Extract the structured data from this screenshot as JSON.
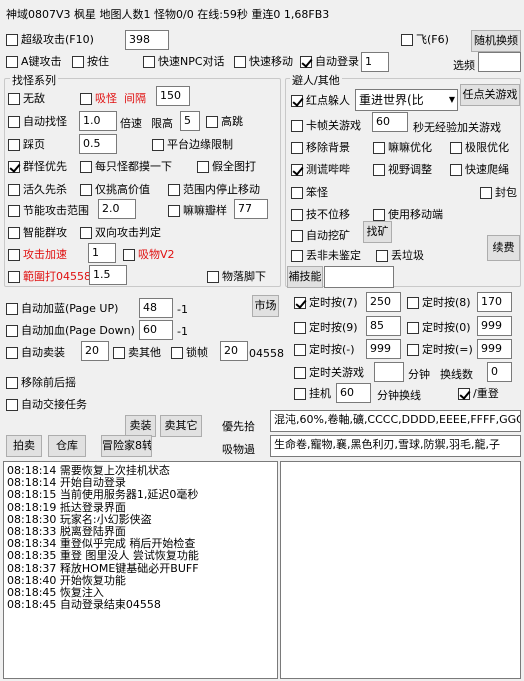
{
  "title": "神域0807V3 枫星 地图人数1 怪物0/0 在线:59秒 重连0   1,68FB3",
  "top": {
    "super_attack": {
      "label": "超级攻击(F10)",
      "value": "398",
      "checked": false
    },
    "fly": {
      "label": "飞(F6)",
      "checked": false
    },
    "random_swap_btn": "随机换频",
    "a_attack": {
      "label": "A键攻击",
      "checked": false
    },
    "hold": {
      "label": "按住",
      "checked": false
    },
    "fast_npc": {
      "label": "快速NPC对话",
      "checked": false
    },
    "fast_move": {
      "label": "快速移动",
      "checked": false
    },
    "auto_login": {
      "label": "自动登录",
      "value": "1",
      "checked": true
    },
    "select_label": "选频"
  },
  "monster": {
    "group_label": "找怪系列",
    "invincible": "无敌",
    "suck_monster": "吸怪",
    "interval": "间隔",
    "interval_value": "150",
    "auto_find": "自动找怪",
    "speed_value": "1.0",
    "speed_label": "倍速",
    "height_limit": "限高",
    "height_value": "5",
    "high_jump": "高跳",
    "step_back": "踩页",
    "step_value": "0.5",
    "platform_limit": "平台边缘限制",
    "group_first": "群怪优先",
    "touch_each": "每只怪都摸一下",
    "fake_map": "假全图打",
    "live_kill": "活久先杀",
    "attack_high": "仅挑高价值",
    "stop_in_range": "范围内停止移动",
    "save_range": "节能攻击范围",
    "save_range_value": "2.0",
    "bite": "嘛嘛瓣样",
    "bite_value": "77",
    "smart_group": "智能群攻",
    "bidirectional": "双向攻击判定",
    "attack_speed": "攻击加速",
    "attack_speed_value": "1",
    "suck_v2": "吸物V2",
    "range_attack": "範圍打04558",
    "range_attack_value": "1.5",
    "item_under_foot": "物落脚下"
  },
  "other": {
    "group_label": "避人/其他",
    "red_dot": {
      "label": "红点躲人",
      "checked": true
    },
    "red_dot_select": "重进世界(比",
    "red_dot_btn": "任点关游戏",
    "stuck_close": "卡帧关游戏",
    "stuck_value": "60",
    "stuck_suffix": "秒无经验加关游戏",
    "move_bg": "移除背景",
    "blur_opt": "嘛嘛优化",
    "extreme_opt": "极限优化",
    "measure_beep": {
      "label": "测谎哔哔",
      "checked": true
    },
    "view_adjust": "视野调整",
    "fast_climb": "快速爬绳",
    "clumsy": "笨怪",
    "seal": "封包",
    "no_move": "技不位移",
    "use_move_end": "使用移动端",
    "auto_mine": "自动挖矿",
    "find_mine_btn": "找矿",
    "lose_unjudged": "丢非未鉴定",
    "lose_trash": "丢垃圾",
    "buy_btn": "補技能",
    "continue_btn": "续费",
    "buy_input": ""
  },
  "mid": {
    "auto_mp": {
      "label": "自动加蓝(Page UP)",
      "value": "48",
      "suffix": "-1"
    },
    "auto_hp": {
      "label": "自动加血(Page Down)",
      "value": "60",
      "suffix": "-1"
    },
    "market_btn": "市场",
    "auto_sell": {
      "label": "自动卖装",
      "value": "20"
    },
    "sell_other": "卖其他",
    "lock_frame": {
      "label": "锁帧",
      "value": "20"
    },
    "frame_code": "04558",
    "remove_before": "移除前后摇",
    "auto_trade": "自动交接任务",
    "sell_equip_btn": "卖装",
    "sell_other_btn": "卖其它",
    "priority_pick": "優先拾",
    "pick_list": "混沌,60%,卷軸,礦,CCCC,DDDD,EEEE,FFFF,GGGG",
    "suck_label": "吸物過",
    "suck_list": "生命卷,寵物,襄,黑色利刃,雪球,防禦,羽毛,龍,子",
    "auction_btn": "拍卖",
    "warehouse_btn": "仓库",
    "adventurer_btn": "冒险家8转"
  },
  "timers": [
    {
      "label": "定时按(7)",
      "value": "250",
      "checked": true
    },
    {
      "label": "定时按(8)",
      "value": "170",
      "checked": false
    },
    {
      "label": "定时按(9)",
      "value": "85",
      "checked": false
    },
    {
      "label": "定时按(0)",
      "value": "999",
      "checked": false
    },
    {
      "label": "定时按(-)",
      "value": "999",
      "checked": false
    },
    {
      "label": "定时按(=)",
      "value": "999",
      "checked": false
    }
  ],
  "timer_close": {
    "label": "定时关游戏",
    "value": "",
    "unit": "分钟",
    "swap_label": "换线数",
    "swap_value": "0"
  },
  "hang": {
    "label": "挂机",
    "value": "60",
    "unit": "分钟换线",
    "rehang": "/重登",
    "checked": false,
    "rehang_checked": true
  },
  "log": [
    "08:18:14 需要恢复上次挂机状态",
    "08:18:14 开始自动登录",
    "08:18:15 当前使用服务器1,延迟0毫秒",
    "08:18:19 抵达登录界面",
    "08:18:30 玩家名:小幻影侠盗",
    "08:18:33 脱离登陆界面",
    "08:18:34 重登似乎完成 稍后开始检查",
    "08:18:35 重登 图里没人 尝试恢复功能",
    "08:18:37 释放HOME键基础必开BUFF",
    "08:18:40 开始恢复功能",
    "08:18:45 恢复注入",
    "08:18:45 自动登录结束04558"
  ]
}
